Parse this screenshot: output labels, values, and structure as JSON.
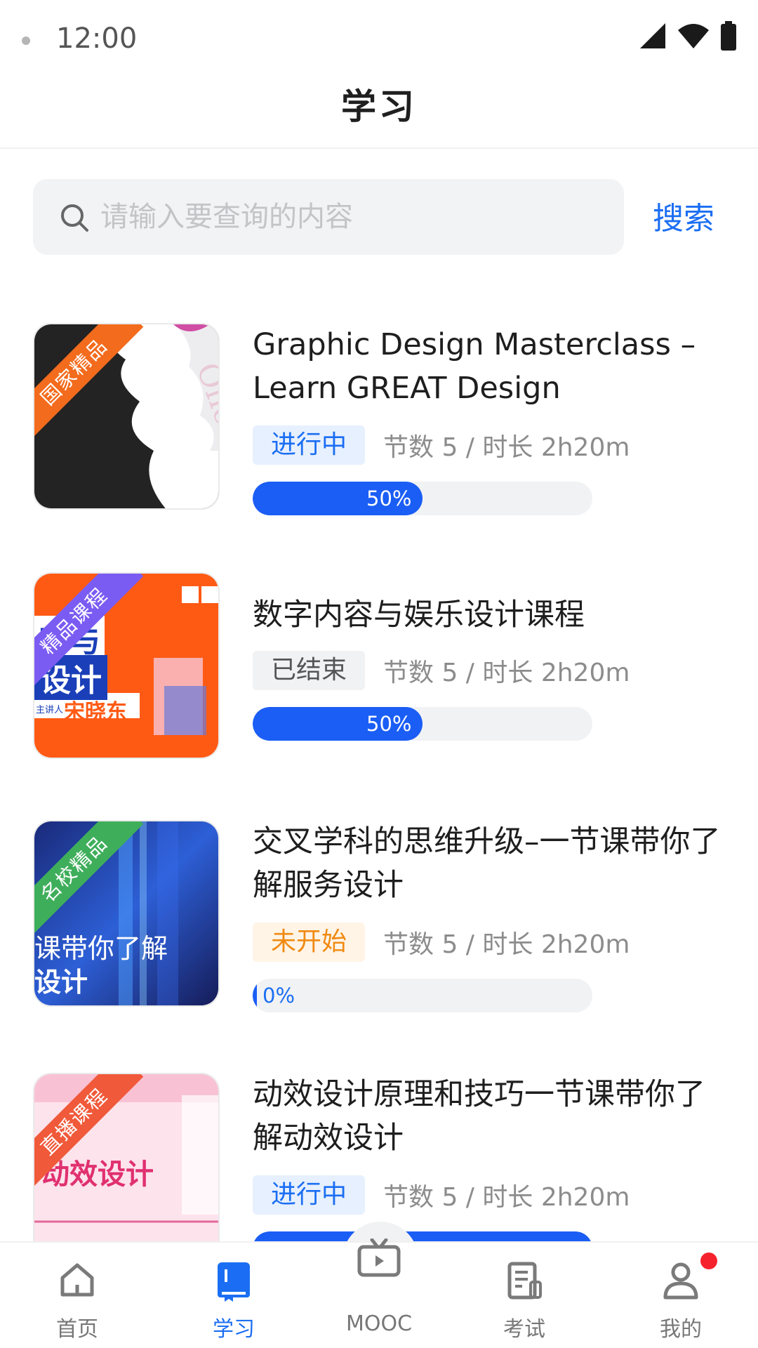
{
  "status_bar": {
    "time": "12:00"
  },
  "page": {
    "title": "学习"
  },
  "search": {
    "placeholder": "请输入要查询的内容",
    "button_label": "搜索"
  },
  "courses": [
    {
      "ribbon": "国家精品",
      "ribbon_color": "#f36b1c",
      "title": "Graphic Design Masterclass – Learn GREAT Design",
      "status": "进行中",
      "meta": "节数 5 / 时长 2h20m",
      "progress": 0.5,
      "progress_label": "50%"
    },
    {
      "ribbon": "精品课程",
      "ribbon_color": "#7b5cf2",
      "title": "数字内容与娱乐设计课程",
      "status": "已结束",
      "meta": "节数 5 / 时长 2h20m",
      "progress": 0.5,
      "progress_label": "50%",
      "thumb_text": {
        "line1": "容与",
        "line2": "设计",
        "presenter_prefix": "主讲人",
        "presenter": "宋晓东"
      }
    },
    {
      "ribbon": "名校精品",
      "ribbon_color": "#3fae5b",
      "title": "交叉学科的思维升级–一节课带你了解服务设计",
      "status": "未开始",
      "meta": "节数 5 / 时长 2h20m",
      "progress": 0,
      "progress_label": "0%",
      "thumb_text": {
        "line1": "课带你了解",
        "line2": "设计"
      }
    },
    {
      "ribbon": "直播课程",
      "ribbon_color": "#f05a3a",
      "title": "动效设计原理和技巧一节课带你了解动效设计",
      "status": "进行中",
      "meta": "节数 5 / 时长 2h20m",
      "progress": 1.0,
      "thumb_text": {
        "line1": "动效设计"
      }
    }
  ],
  "bottom_nav": {
    "items": [
      {
        "label": "首页",
        "icon": "home-icon",
        "active": false
      },
      {
        "label": "学习",
        "icon": "study-book-icon",
        "active": true
      },
      {
        "label": "MOOC",
        "icon": "tv-play-icon",
        "active": false
      },
      {
        "label": "考试",
        "icon": "exam-sheet-icon",
        "active": false
      },
      {
        "label": "我的",
        "icon": "user-icon",
        "active": false,
        "has_notification": true
      }
    ]
  },
  "colors": {
    "accent": "#1b6ef3",
    "progress": "#1b5ef5",
    "notification": "#f5222d"
  }
}
